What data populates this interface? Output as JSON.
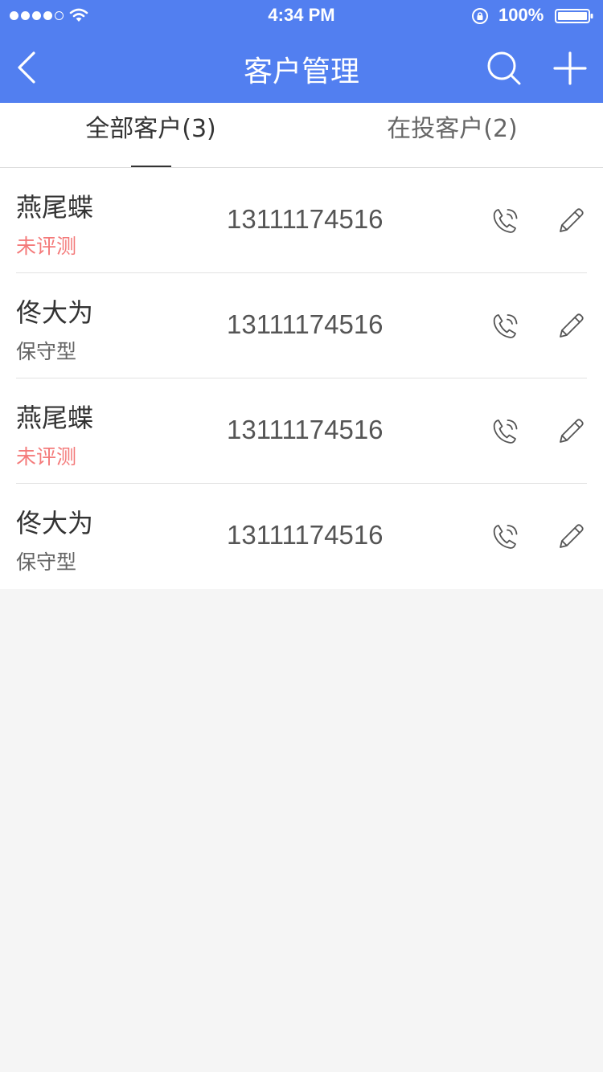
{
  "status_bar": {
    "time": "4:34 PM",
    "battery_percent": "100%",
    "signal_strength": 4,
    "signal_max": 5,
    "battery_level": 1.0
  },
  "nav": {
    "title": "客户管理",
    "back_icon": "chevron-left-icon",
    "search_icon": "search-icon",
    "add_icon": "plus-icon"
  },
  "tabs": [
    {
      "label": "全部客户(3)",
      "active": true
    },
    {
      "label": "在投客户(2)",
      "active": false
    }
  ],
  "colors": {
    "primary": "#527ff0",
    "risk_unassessed": "#f47a7a",
    "risk_normal": "#666666"
  },
  "customers": [
    {
      "name": "燕尾蝶",
      "risk": "未评测",
      "phone": "13111174516",
      "risk_status": "unassessed"
    },
    {
      "name": "佟大为",
      "risk": "保守型",
      "phone": "13111174516",
      "risk_status": "assessed"
    },
    {
      "name": "燕尾蝶",
      "risk": "未评测",
      "phone": "13111174516",
      "risk_status": "unassessed"
    },
    {
      "name": "佟大为",
      "risk": "保守型",
      "phone": "13111174516",
      "risk_status": "assessed"
    }
  ]
}
